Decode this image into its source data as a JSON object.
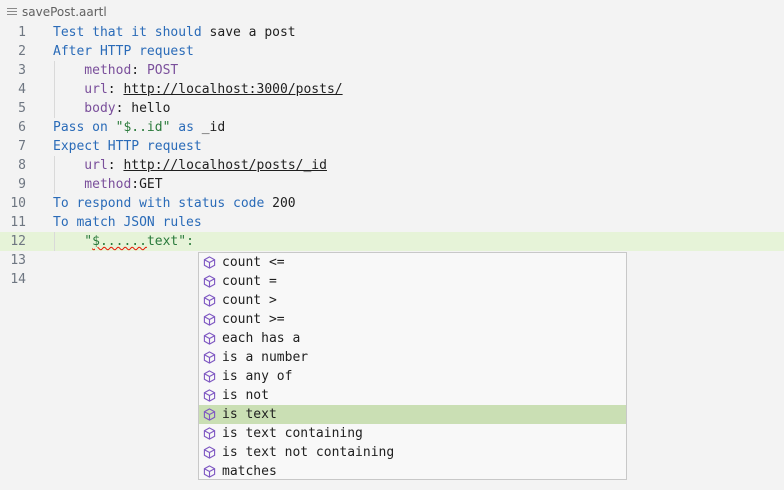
{
  "tab": {
    "title": "savePost.aartl",
    "icon": "lines-icon"
  },
  "lines": [
    {
      "n": "1",
      "parts": [
        {
          "t": "Test that it should",
          "c": "kw"
        },
        {
          "t": " save a post",
          "c": "txt"
        }
      ]
    },
    {
      "n": "2",
      "parts": [
        {
          "t": "After HTTP request",
          "c": "kw"
        }
      ]
    },
    {
      "n": "3",
      "parts": [
        {
          "t": "    method",
          "c": "prop"
        },
        {
          "t": ": ",
          "c": "txt"
        },
        {
          "t": "POST",
          "c": "prop"
        }
      ]
    },
    {
      "n": "4",
      "parts": [
        {
          "t": "    url",
          "c": "prop"
        },
        {
          "t": ": ",
          "c": "txt"
        },
        {
          "t": "http://localhost:3000/posts/",
          "c": "val"
        }
      ]
    },
    {
      "n": "5",
      "parts": [
        {
          "t": "    body",
          "c": "prop"
        },
        {
          "t": ": hello",
          "c": "txt"
        }
      ]
    },
    {
      "n": "6",
      "parts": [
        {
          "t": "Pass on ",
          "c": "kw"
        },
        {
          "t": "\"$..id\"",
          "c": "str"
        },
        {
          "t": " as ",
          "c": "kw"
        },
        {
          "t": "_id",
          "c": "txt"
        }
      ]
    },
    {
      "n": "7",
      "parts": [
        {
          "t": "Expect HTTP request",
          "c": "kw"
        }
      ]
    },
    {
      "n": "8",
      "parts": [
        {
          "t": "    url",
          "c": "prop"
        },
        {
          "t": ": ",
          "c": "txt"
        },
        {
          "t": "http://localhost/posts/_id",
          "c": "val"
        }
      ]
    },
    {
      "n": "9",
      "parts": [
        {
          "t": "    method",
          "c": "prop"
        },
        {
          "t": ":GET",
          "c": "txt"
        }
      ]
    },
    {
      "n": "10",
      "parts": [
        {
          "t": "To respond with status code",
          "c": "kw"
        },
        {
          "t": " 200",
          "c": "num"
        }
      ]
    },
    {
      "n": "11",
      "parts": [
        {
          "t": "To match JSON rules",
          "c": "kw"
        }
      ]
    },
    {
      "n": "12",
      "parts": [
        {
          "t": "    \"",
          "c": "str"
        },
        {
          "t": "$......",
          "c": "str err"
        },
        {
          "t": "text\":",
          "c": "str"
        }
      ],
      "current": true
    },
    {
      "n": "13",
      "parts": []
    },
    {
      "n": "14",
      "parts": []
    }
  ],
  "suggestions": {
    "icon": "cube-icon",
    "items": [
      {
        "label": "count <="
      },
      {
        "label": "count ="
      },
      {
        "label": "count >"
      },
      {
        "label": "count >="
      },
      {
        "label": "each has a"
      },
      {
        "label": "is a number"
      },
      {
        "label": "is any of"
      },
      {
        "label": "is not"
      },
      {
        "label": "is text",
        "selected": true
      },
      {
        "label": "is text containing"
      },
      {
        "label": "is text not containing"
      },
      {
        "label": "matches"
      }
    ]
  }
}
